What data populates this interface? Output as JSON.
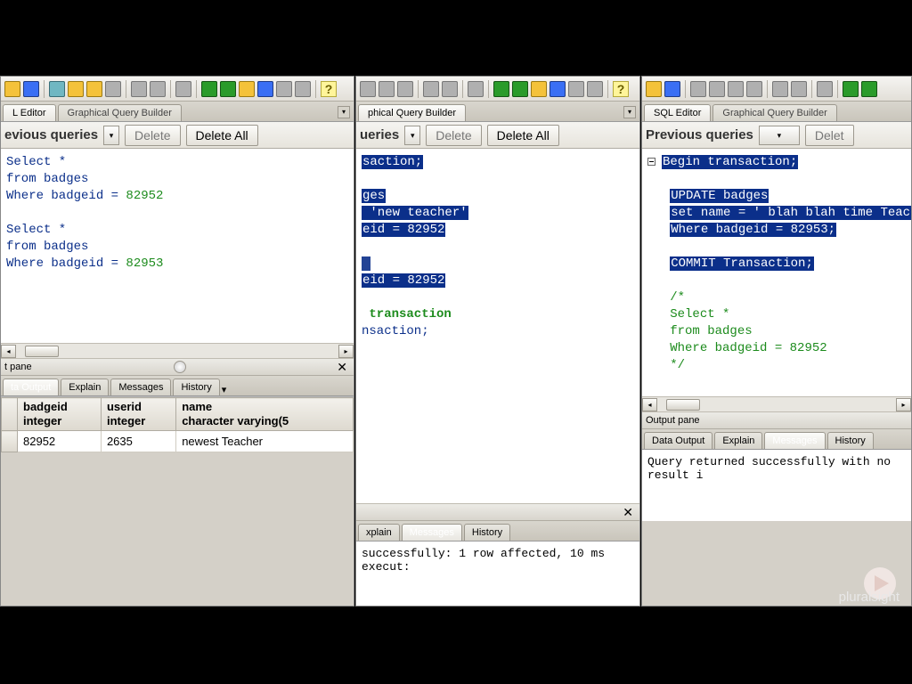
{
  "common": {
    "tabs": {
      "sql_editor": "SQL Editor",
      "gqb": "Graphical Query Builder"
    },
    "queries": {
      "label": "Previous queries",
      "label_trunc1": "evious queries",
      "label_trunc2": "ueries",
      "delete": "Delete",
      "delete_all": "Delete All",
      "delete_trunc": "Delet"
    },
    "output_tabs": {
      "data_output": "Data Output",
      "explain": "Explain",
      "messages": "Messages",
      "history": "History"
    },
    "output_pane_label": "Output pane",
    "output_pane_label_trunc": "t pane",
    "watermark": "pluralsight"
  },
  "pane1": {
    "tabs_sql_editor_trunc": "L Editor",
    "sql": {
      "l1": "Select *",
      "l2": "from badges",
      "l3_a": "Where badgeid = ",
      "l3_b": "82952",
      "l5": "Select *",
      "l6": "from badges",
      "l7_a": "Where badgeid = ",
      "l7_b": "82953"
    },
    "data_output_trunc": "ta Output",
    "columns": {
      "c1_name": "badgeid",
      "c1_type": "integer",
      "c2_name": "userid",
      "c2_type": "integer",
      "c3_name": "name",
      "c3_type": "character varying(5"
    },
    "row": {
      "badgeid": "82952",
      "userid": "2635",
      "name": "newest Teacher"
    }
  },
  "pane2": {
    "gqb_trunc": "phical Query Builder",
    "sql": {
      "l1": "saction;",
      "l3": "ges",
      "l4": " 'new teacher'",
      "l5": "eid = 82952",
      "l8": "eid = 82952",
      "l10": " transaction",
      "l11": "nsaction;"
    },
    "explain_trunc": "xplain",
    "message": " successfully: 1 row affected, 10 ms execut:"
  },
  "pane3": {
    "sql": {
      "l1": "Begin transaction;",
      "l3": "UPDATE badges",
      "l4": "set name = ' blah blah time Teacher'",
      "l5": "Where badgeid = 82953;",
      "l7": "COMMIT Transaction;",
      "c1": "/*",
      "c2": "Select *",
      "c3": "from badges",
      "c4": "Where badgeid = 82952",
      "c5": "*/"
    },
    "message": "Query returned successfully with no result i"
  }
}
